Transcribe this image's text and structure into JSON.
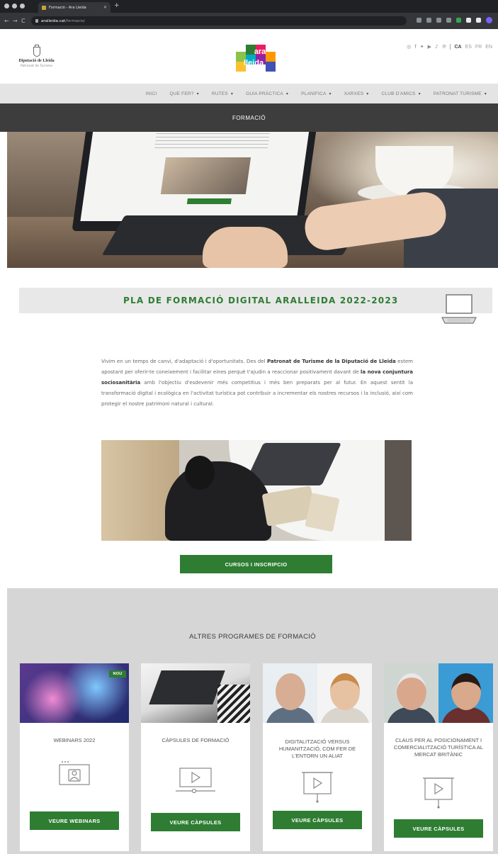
{
  "browser": {
    "tab_title": "Formació - Ara Lleida",
    "url_host": "aralleida.cat",
    "url_path": "/formacio/"
  },
  "header": {
    "diputacio_name": "Diputació de Lleida",
    "diputacio_sub": "Patronat de Turisme",
    "logo_text_1": "ara",
    "logo_text_2": "lleida",
    "languages": [
      "CA",
      "ES",
      "FR",
      "EN"
    ]
  },
  "menu": {
    "items": [
      {
        "label": "INICI"
      },
      {
        "label": "QUE FER?"
      },
      {
        "label": "RUTES"
      },
      {
        "label": "GUIA PRÀCTICA"
      },
      {
        "label": "PLANIFICA"
      },
      {
        "label": "XARXES"
      },
      {
        "label": "CLUB D'AMICS"
      },
      {
        "label": "PATRONAT TURISME"
      }
    ]
  },
  "page_title": "FORMACIÓ",
  "pla": {
    "title": "PLA DE FORMACIÓ DIGITAL ARALLEIDA 2022-2023",
    "intro_1": "Vivim en un temps de canvi, d'adaptació i d'oportunitats. Des del ",
    "intro_b1": "Patronat de Turisme de la Diputació de Lleida",
    "intro_2": " estem apostant per oferir-te coneixement i facilitar eines perquè t'ajudin a reaccionar positivament davant de ",
    "intro_b2": "la nova conjuntura sociosanitària",
    "intro_3": " amb l'objectiu d'esdevenir més competitius i més ben preparats per al futur. En aquest sentit la transformació digital i ecològica en l'activitat turística pot contribuir a incrementar els nostres recursos i la inclusió, així com protegir el nostre patrimoni natural i cultural.",
    "button": "CURSOS I INSCRIPCIO"
  },
  "altres": {
    "title": "ALTRES PROGRAMES DE FORMACIÓ",
    "cards": [
      {
        "title": "WEBINARS 2022",
        "badge": "NOU",
        "button": "VEURE WEBINARS",
        "icon": "webinar-user-icon"
      },
      {
        "title": "CÀPSULES DE FORMACIÓ",
        "button": "VEURE CÀPSULES",
        "icon": "video-player-icon"
      },
      {
        "title": "DIGITALITZACIÓ VERSUS HUMANITZACIÓ, COM FER DE L'ENTORN UN ALIAT",
        "button": "VEURE CÀPSULES",
        "icon": "video-screen-icon"
      },
      {
        "title": "CLAUS PER AL POSICIONAMENT I COMERCIALITZACIÓ TURÍSTICA AL MERCAT BRITÀNIC",
        "button": "VEURE CÀPSULES",
        "icon": "video-screen-icon"
      }
    ]
  },
  "colors": {
    "brand_green": "#2e7d32",
    "title_bar": "#3d3d3d",
    "menu_bg": "#e4e4e4",
    "section_bg": "#d6d6d6"
  }
}
